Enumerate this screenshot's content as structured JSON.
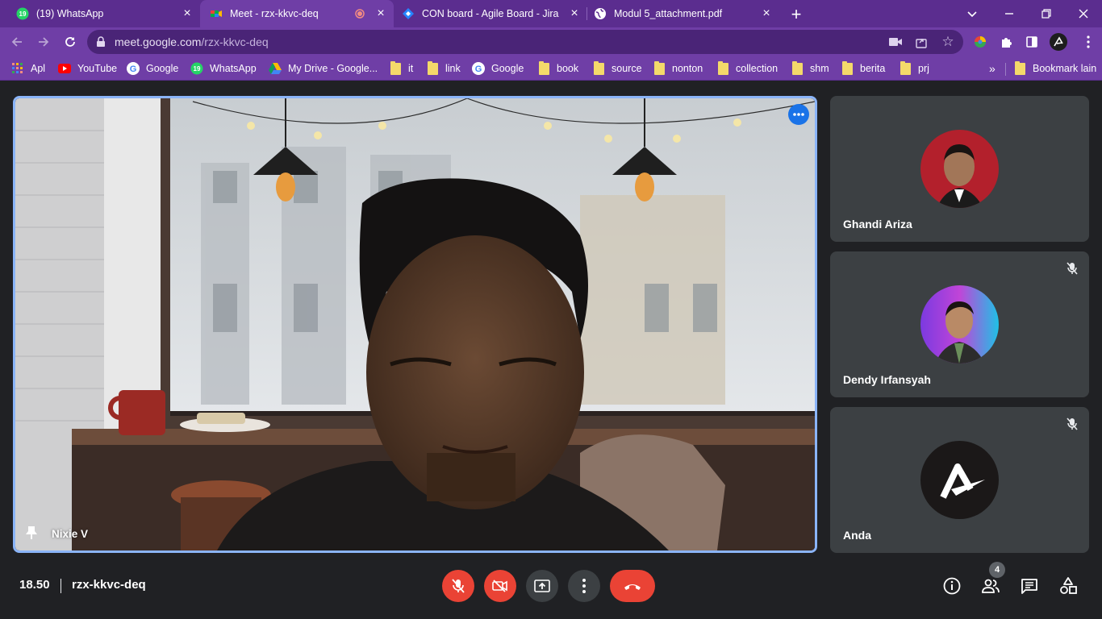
{
  "browser": {
    "tabs": [
      {
        "title": "(19) WhatsApp",
        "badge": "19"
      },
      {
        "title": "Meet - rzx-kkvc-deq"
      },
      {
        "title": "CON board - Agile Board - Jira"
      },
      {
        "title": "Modul 5_attachment.pdf"
      }
    ],
    "url_host": "meet.google.com",
    "url_path": "/rzx-kkvc-deq",
    "bookmarks": [
      "Apl",
      "YouTube",
      "Google",
      "WhatsApp",
      "My Drive - Google...",
      "it",
      "link",
      "Google",
      "book",
      "source",
      "nonton",
      "collection",
      "shm",
      "berita",
      "prj"
    ],
    "bookmark_more": "»",
    "bookmark_other": "Bookmark lain"
  },
  "meet": {
    "presenter_name": "Nixie V",
    "participants": [
      {
        "name": "Ghandi Ariza",
        "muted": false
      },
      {
        "name": "Dendy Irfansyah",
        "muted": true
      },
      {
        "name": "Anda",
        "muted": true
      }
    ],
    "time": "18.50",
    "meeting_code": "rzx-kkvc-deq",
    "people_count": "4"
  },
  "colors": {
    "chrome": "#6f3ea6",
    "tabbar": "#5b2d8f",
    "meet_bg": "#202124",
    "tile": "#3c4043",
    "danger": "#ea4335",
    "focus": "#8ab4f8"
  }
}
